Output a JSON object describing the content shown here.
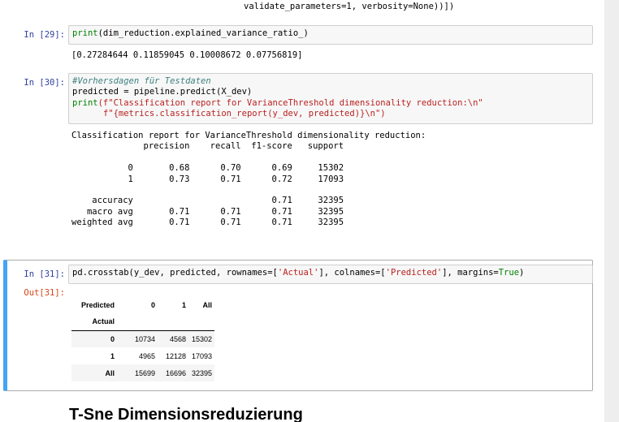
{
  "top_line": "validate_parameters=1, verbosity=None))])",
  "cell29": {
    "prompt": "In [29]:",
    "code": "print(dim_reduction.explained_variance_ratio_)",
    "output": "[0.27284644 0.11859045 0.10008672 0.07756819]"
  },
  "cell30": {
    "prompt": "In [30]:",
    "comment": "#Vorhersdagen für Testdaten",
    "line2": "predicted = pipeline.predict(X_dev)",
    "line3_fn": "print",
    "line3_str": "(f\"Classification report for VarianceThreshold dimensionality reduction:\\n\"",
    "line4_str": "f\"{metrics.classification_report(y_dev, predicted)}\\n\")",
    "output": "Classification report for VarianceThreshold dimensionality reduction:\n              precision    recall  f1-score   support\n\n           0       0.68      0.70      0.69     15302\n           1       0.73      0.71      0.72     17093\n\n    accuracy                           0.71     32395\n   macro avg       0.71      0.71      0.71     32395\nweighted avg       0.71      0.71      0.71     32395"
  },
  "cell31": {
    "in_prompt": "In [31]:",
    "out_prompt": "Out[31]:",
    "code_pre": "pd.crosstab(y_dev, predicted, rownames=[",
    "code_s1": "'Actual'",
    "code_mid": "], colnames=[",
    "code_s2": "'Predicted'",
    "code_mid2": "], margins=",
    "code_kw": "True",
    "code_end": ")",
    "table": {
      "col_axis_label": "Predicted",
      "columns": [
        "0",
        "1",
        "All"
      ],
      "row_axis_label": "Actual",
      "rows": [
        {
          "label": "0",
          "values": [
            "10734",
            "4568",
            "15302"
          ]
        },
        {
          "label": "1",
          "values": [
            "4965",
            "12128",
            "17093"
          ]
        },
        {
          "label": "All",
          "values": [
            "15699",
            "16696",
            "32395"
          ]
        }
      ]
    }
  },
  "heading": "T-Sne Dimensionsreduzierung"
}
